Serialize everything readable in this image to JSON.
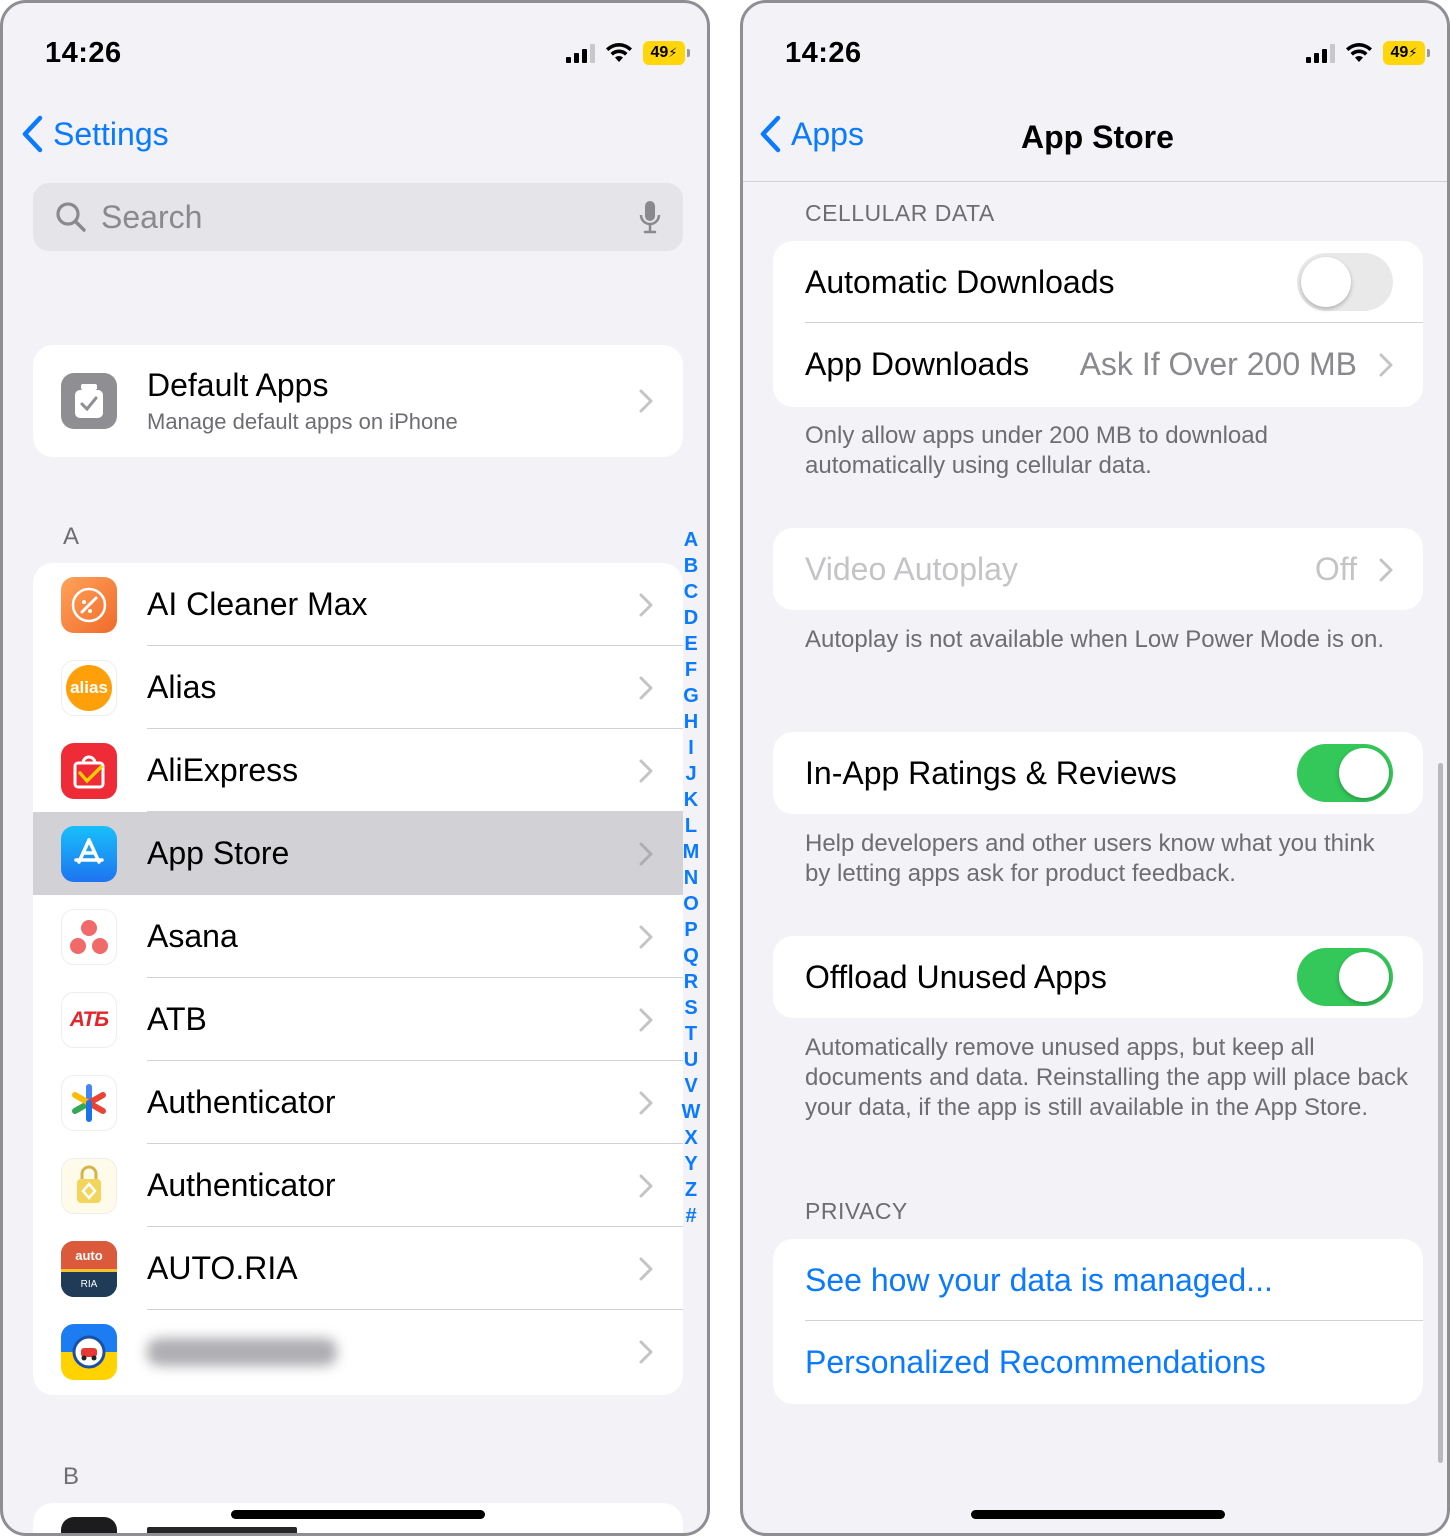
{
  "left": {
    "status": {
      "time": "14:26",
      "battery": "49"
    },
    "back_label": "Settings",
    "search": {
      "placeholder": "Search"
    },
    "default_apps": {
      "title": "Default Apps",
      "subtitle": "Manage default apps on iPhone"
    },
    "section_a": "A",
    "section_b": "B",
    "apps": [
      {
        "label": "AI Cleaner Max",
        "icon": "ai-cleaner-icon"
      },
      {
        "label": "Alias",
        "icon": "alias-icon"
      },
      {
        "label": "AliExpress",
        "icon": "aliexpress-icon"
      },
      {
        "label": "App Store",
        "icon": "app-store-icon"
      },
      {
        "label": "Asana",
        "icon": "asana-icon"
      },
      {
        "label": "ATB",
        "icon": "atb-icon"
      },
      {
        "label": "Authenticator",
        "icon": "google-authenticator-icon"
      },
      {
        "label": "Authenticator",
        "icon": "binance-authenticator-icon"
      },
      {
        "label": "AUTO.RIA",
        "icon": "auto-ria-icon"
      }
    ],
    "icon_text": {
      "alias": "alias",
      "atb": "ATБ",
      "autoria_top": "auto",
      "autoria_bottom": "RIA"
    },
    "index_letters": [
      "A",
      "B",
      "C",
      "D",
      "E",
      "F",
      "G",
      "H",
      "I",
      "J",
      "K",
      "L",
      "M",
      "N",
      "O",
      "P",
      "Q",
      "R",
      "S",
      "T",
      "U",
      "V",
      "W",
      "X",
      "Y",
      "Z",
      "#"
    ]
  },
  "right": {
    "status": {
      "time": "14:26",
      "battery": "49"
    },
    "back_label": "Apps",
    "title": "App Store",
    "cellular_header": "CELLULAR DATA",
    "automatic_downloads": {
      "label": "Automatic Downloads",
      "on": false
    },
    "app_downloads": {
      "label": "App Downloads",
      "value": "Ask If Over 200 MB"
    },
    "cellular_footer": "Only allow apps under 200 MB to download automatically using cellular data.",
    "video_autoplay": {
      "label": "Video Autoplay",
      "value": "Off"
    },
    "autoplay_footer": "Autoplay is not available when Low Power Mode is on.",
    "ratings": {
      "label": "In-App Ratings & Reviews",
      "on": true
    },
    "ratings_footer": "Help developers and other users know what you think by letting apps ask for product feedback.",
    "offload": {
      "label": "Offload Unused Apps",
      "on": true
    },
    "offload_footer": "Automatically remove unused apps, but keep all documents and data. Reinstalling the app will place back your data, if the app is still available in the App Store.",
    "privacy_header": "PRIVACY",
    "privacy_link_1": "See how your data is managed...",
    "privacy_link_2": "Personalized Recommendations"
  },
  "colors": {
    "accent": "#0a7aff",
    "toggle_on": "#34c759",
    "background": "#f2f2f7",
    "secondary_text": "#6d6d72"
  }
}
